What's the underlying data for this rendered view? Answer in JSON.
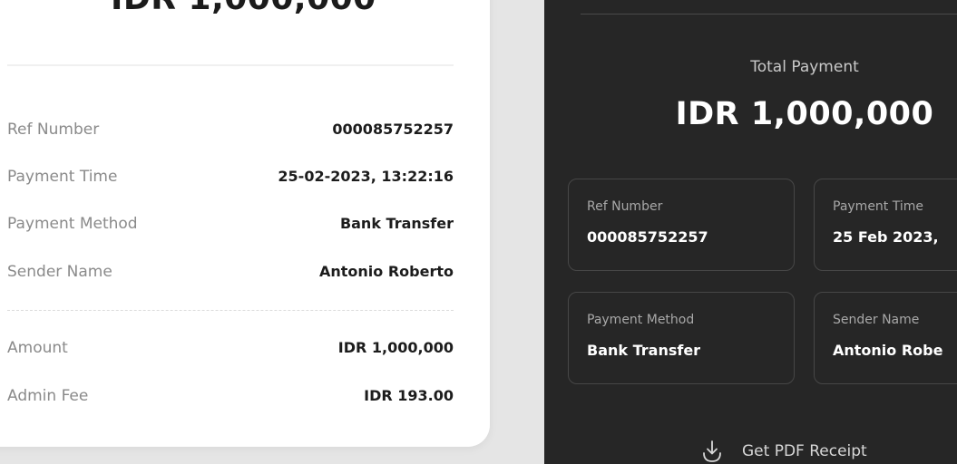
{
  "light_card": {
    "amount": "IDR 1,000,000",
    "rows": [
      {
        "label": "Ref Number",
        "value": "000085752257"
      },
      {
        "label": "Payment Time",
        "value": "25-02-2023, 13:22:16"
      },
      {
        "label": "Payment Method",
        "value": "Bank Transfer"
      },
      {
        "label": "Sender Name",
        "value": "Antonio Roberto"
      }
    ],
    "fees": [
      {
        "label": "Amount",
        "value": "IDR 1,000,000"
      },
      {
        "label": "Admin Fee",
        "value": "IDR 193.00"
      }
    ]
  },
  "dark_card": {
    "total_label": "Total Payment",
    "total_amount": "IDR 1,000,000",
    "boxes": [
      {
        "label": "Ref Number",
        "value": "000085752257"
      },
      {
        "label": "Payment Time",
        "value": "25 Feb 2023,"
      },
      {
        "label": "Payment Method",
        "value": "Bank Transfer"
      },
      {
        "label": "Sender Name",
        "value": "Antonio Robe"
      }
    ],
    "pdf_label": "Get PDF Receipt"
  },
  "icons": {
    "download": "download-icon"
  },
  "colors": {
    "dark_bg": "#262626",
    "light_bg": "#ffffff",
    "page_bg": "#e5e5e5"
  }
}
